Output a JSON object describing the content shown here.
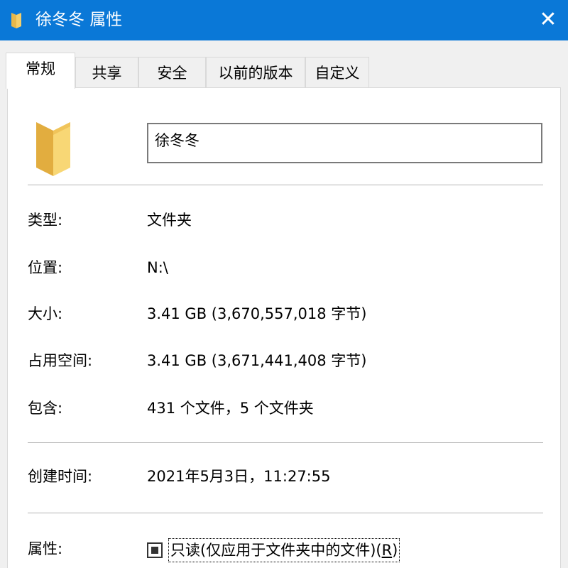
{
  "window": {
    "title": "徐冬冬 属性",
    "title_icon": "folder-icon",
    "close_icon": "close-icon",
    "close_label": "✕",
    "accent_color": "#0a78d7"
  },
  "tabs": [
    {
      "label": "常规",
      "active": true
    },
    {
      "label": "共享",
      "active": false
    },
    {
      "label": "安全",
      "active": false
    },
    {
      "label": "以前的版本",
      "active": false
    },
    {
      "label": "自定义",
      "active": false
    }
  ],
  "general": {
    "folder_icon": "folder-icon",
    "name_value": "徐冬冬",
    "type_label": "类型:",
    "type_value": "文件夹",
    "location_label": "位置:",
    "location_value": "N:\\",
    "size_label": "大小:",
    "size_value": "3.41 GB (3,670,557,018 字节)",
    "disk_size_label": "占用空间:",
    "disk_size_value": "3.41 GB (3,671,441,408 字节)",
    "contains_label": "包含:",
    "contains_value": "431 个文件，5 个文件夹",
    "created_label": "创建时间:",
    "created_value": "2021年5月3日，11:27:55",
    "attributes_label": "属性:",
    "readonly_label": "只读(仅应用于文件夹中的文件)(",
    "readonly_hotkey": "R",
    "readonly_suffix": ")",
    "readonly_state": "indeterminate"
  }
}
